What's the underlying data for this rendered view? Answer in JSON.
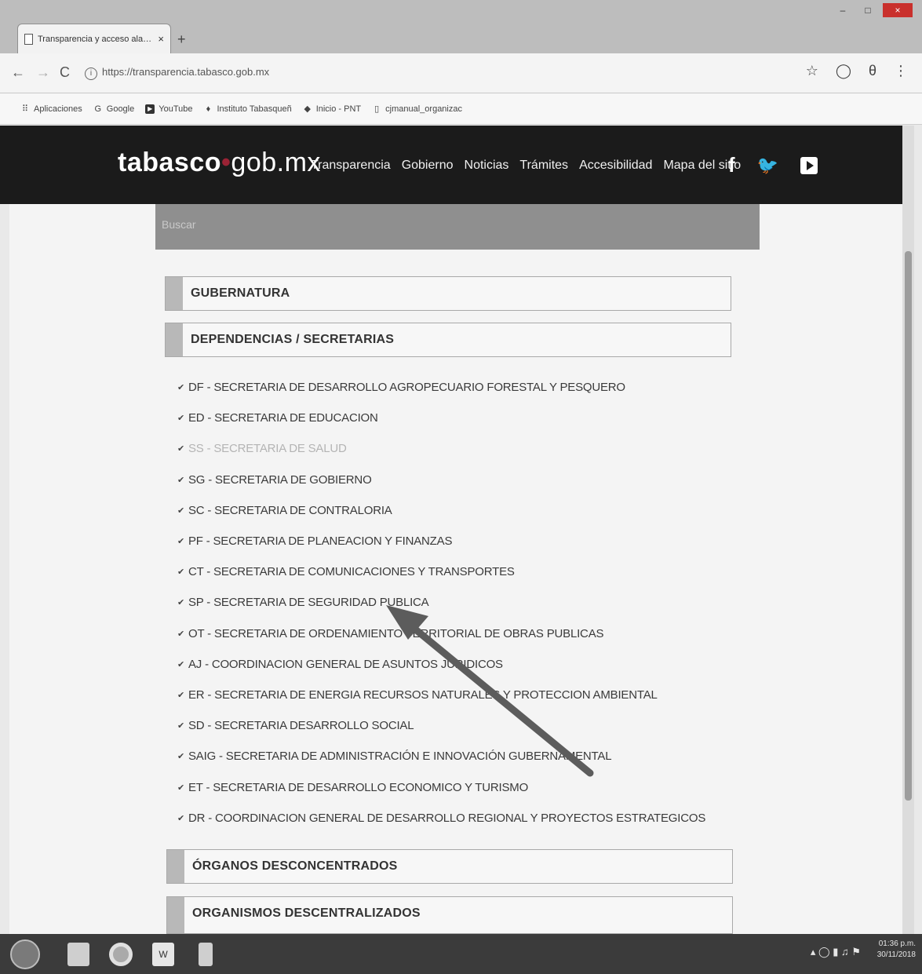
{
  "browser": {
    "tab_title": "Transparencia y acceso ala infor",
    "tab_close": "×",
    "new_tab": "+",
    "url": "https://transparencia.tabasco.gob.mx",
    "window_controls": {
      "minimize": "–",
      "maximize": "□",
      "close": "×"
    },
    "bookmarks": [
      {
        "label": "Aplicaciones",
        "icon": "apps-grid-icon",
        "glyph": "⠿"
      },
      {
        "label": "Google",
        "icon": "google-icon",
        "glyph": "G"
      },
      {
        "label": "YouTube",
        "icon": "youtube-icon",
        "glyph": "▶"
      },
      {
        "label": "Instituto Tabasqueñ",
        "icon": "institute-icon",
        "glyph": "♦"
      },
      {
        "label": "Inicio - PNT",
        "icon": "pnt-icon",
        "glyph": "◆"
      },
      {
        "label": "cjmanual_organizac",
        "icon": "document-icon",
        "glyph": "▯"
      }
    ]
  },
  "site": {
    "logo_brand": "tabasco",
    "logo_dot": "•",
    "logo_domain": "gob.mx",
    "nav": [
      "Transparencia",
      "Gobierno",
      "Noticias",
      "Trámites",
      "Accesibilidad",
      "Mapa del sitio"
    ],
    "social": {
      "facebook": "f",
      "twitter": "🐦"
    }
  },
  "main": {
    "search_placeholder": "Buscar",
    "sections": {
      "gubernatura": "GUBERNATURA",
      "dependencias": "DEPENDENCIAS / SECRETARIAS",
      "organos": "ÓRGANOS DESCONCENTRADOS",
      "organismos": "ORGANISMOS DESCENTRALIZADOS"
    },
    "check_glyph": "✔",
    "dependencias": [
      "DF - SECRETARIA DE DESARROLLO AGROPECUARIO FORESTAL Y PESQUERO",
      "ED - SECRETARIA DE EDUCACION",
      "SS - SECRETARIA DE SALUD",
      "SG - SECRETARIA DE GOBIERNO",
      "SC - SECRETARIA DE CONTRALORIA",
      "PF - SECRETARIA DE PLANEACION Y FINANZAS",
      "CT - SECRETARIA DE COMUNICACIONES Y TRANSPORTES",
      "SP - SECRETARIA DE SEGURIDAD PUBLICA",
      "OT - SECRETARIA DE ORDENAMIENTO TERRITORIAL DE OBRAS PUBLICAS",
      "AJ - COORDINACION GENERAL DE ASUNTOS JURIDICOS",
      "ER - SECRETARIA DE ENERGIA RECURSOS NATURALES Y PROTECCION AMBIENTAL",
      "SD - SECRETARIA DESARROLLO SOCIAL",
      "SAIG - SECRETARIA DE ADMINISTRACIÓN E INNOVACIÓN GUBERNAMENTAL",
      "ET - SECRETARIA DE DESARROLLO ECONOMICO Y TURISMO",
      "DR - COORDINACION GENERAL DE DESARROLLO REGIONAL Y PROYECTOS ESTRATEGICOS"
    ]
  },
  "taskbar": {
    "word_label": "W",
    "time": "01:36 p.m.",
    "date": "30/11/2018"
  }
}
